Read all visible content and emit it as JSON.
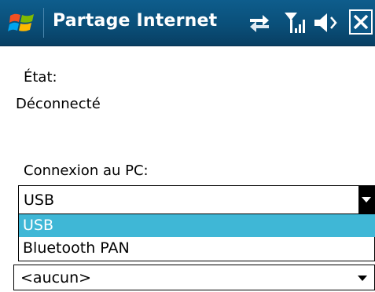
{
  "title_bar": {
    "title": "Partage Internet",
    "icons": [
      "windows-start-icon",
      "connectivity-icon",
      "signal-icon",
      "volume-icon",
      "close-icon"
    ],
    "close_label": "X"
  },
  "status": {
    "label": "État:",
    "value": "Déconnecté"
  },
  "pc_connection": {
    "label": "Connexion au PC:",
    "selected": "USB",
    "options": [
      "USB",
      "Bluetooth PAN"
    ]
  },
  "network_connection": {
    "selected": "<aucun>"
  },
  "colors": {
    "title_bar": "#0a4f79",
    "selection": "#3fb7d6"
  }
}
